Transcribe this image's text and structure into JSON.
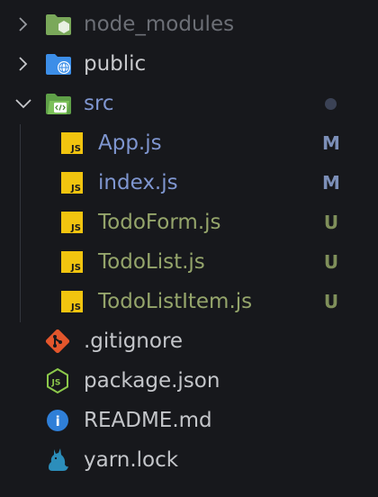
{
  "colors": {
    "background": "#17181c",
    "folder_muted": "#6c6f76",
    "folder_text": "#c8c9cc",
    "modified": "#7f96d0",
    "modified_badge": "#7c8fb8",
    "untracked": "#95a56b",
    "untracked_badge": "#7f8f5a",
    "file_text": "#c4c6ca",
    "js_icon_bg": "#f1c40f",
    "git_icon": "#e3562c",
    "node_icon": "#8cc84b",
    "info_icon": "#2f7fd8",
    "yarn_icon": "#2c8ebb",
    "folder_green": "#6fb04a",
    "folder_blue": "#3c8ee8"
  },
  "explorer": {
    "folders": [
      {
        "label": "node_modules",
        "icon": "node-folder-icon",
        "expanded": false
      },
      {
        "label": "public",
        "icon": "globe-folder-icon",
        "expanded": false
      },
      {
        "label": "src",
        "icon": "code-folder-icon",
        "expanded": true,
        "has_changes": true
      }
    ],
    "src_files": [
      {
        "label": "App.js",
        "icon": "javascript-file-icon",
        "status": "M"
      },
      {
        "label": "index.js",
        "icon": "javascript-file-icon",
        "status": "M"
      },
      {
        "label": "TodoForm.js",
        "icon": "javascript-file-icon",
        "status": "U"
      },
      {
        "label": "TodoList.js",
        "icon": "javascript-file-icon",
        "status": "U"
      },
      {
        "label": "TodoListItem.js",
        "icon": "javascript-file-icon",
        "status": "U"
      }
    ],
    "root_files": [
      {
        "label": ".gitignore",
        "icon": "git-icon"
      },
      {
        "label": "package.json",
        "icon": "nodejs-icon"
      },
      {
        "label": "README.md",
        "icon": "info-icon"
      },
      {
        "label": "yarn.lock",
        "icon": "yarn-cat-icon"
      }
    ],
    "js_icon_text": "JS",
    "json_icon_text": "JS",
    "info_icon_text": "i"
  }
}
